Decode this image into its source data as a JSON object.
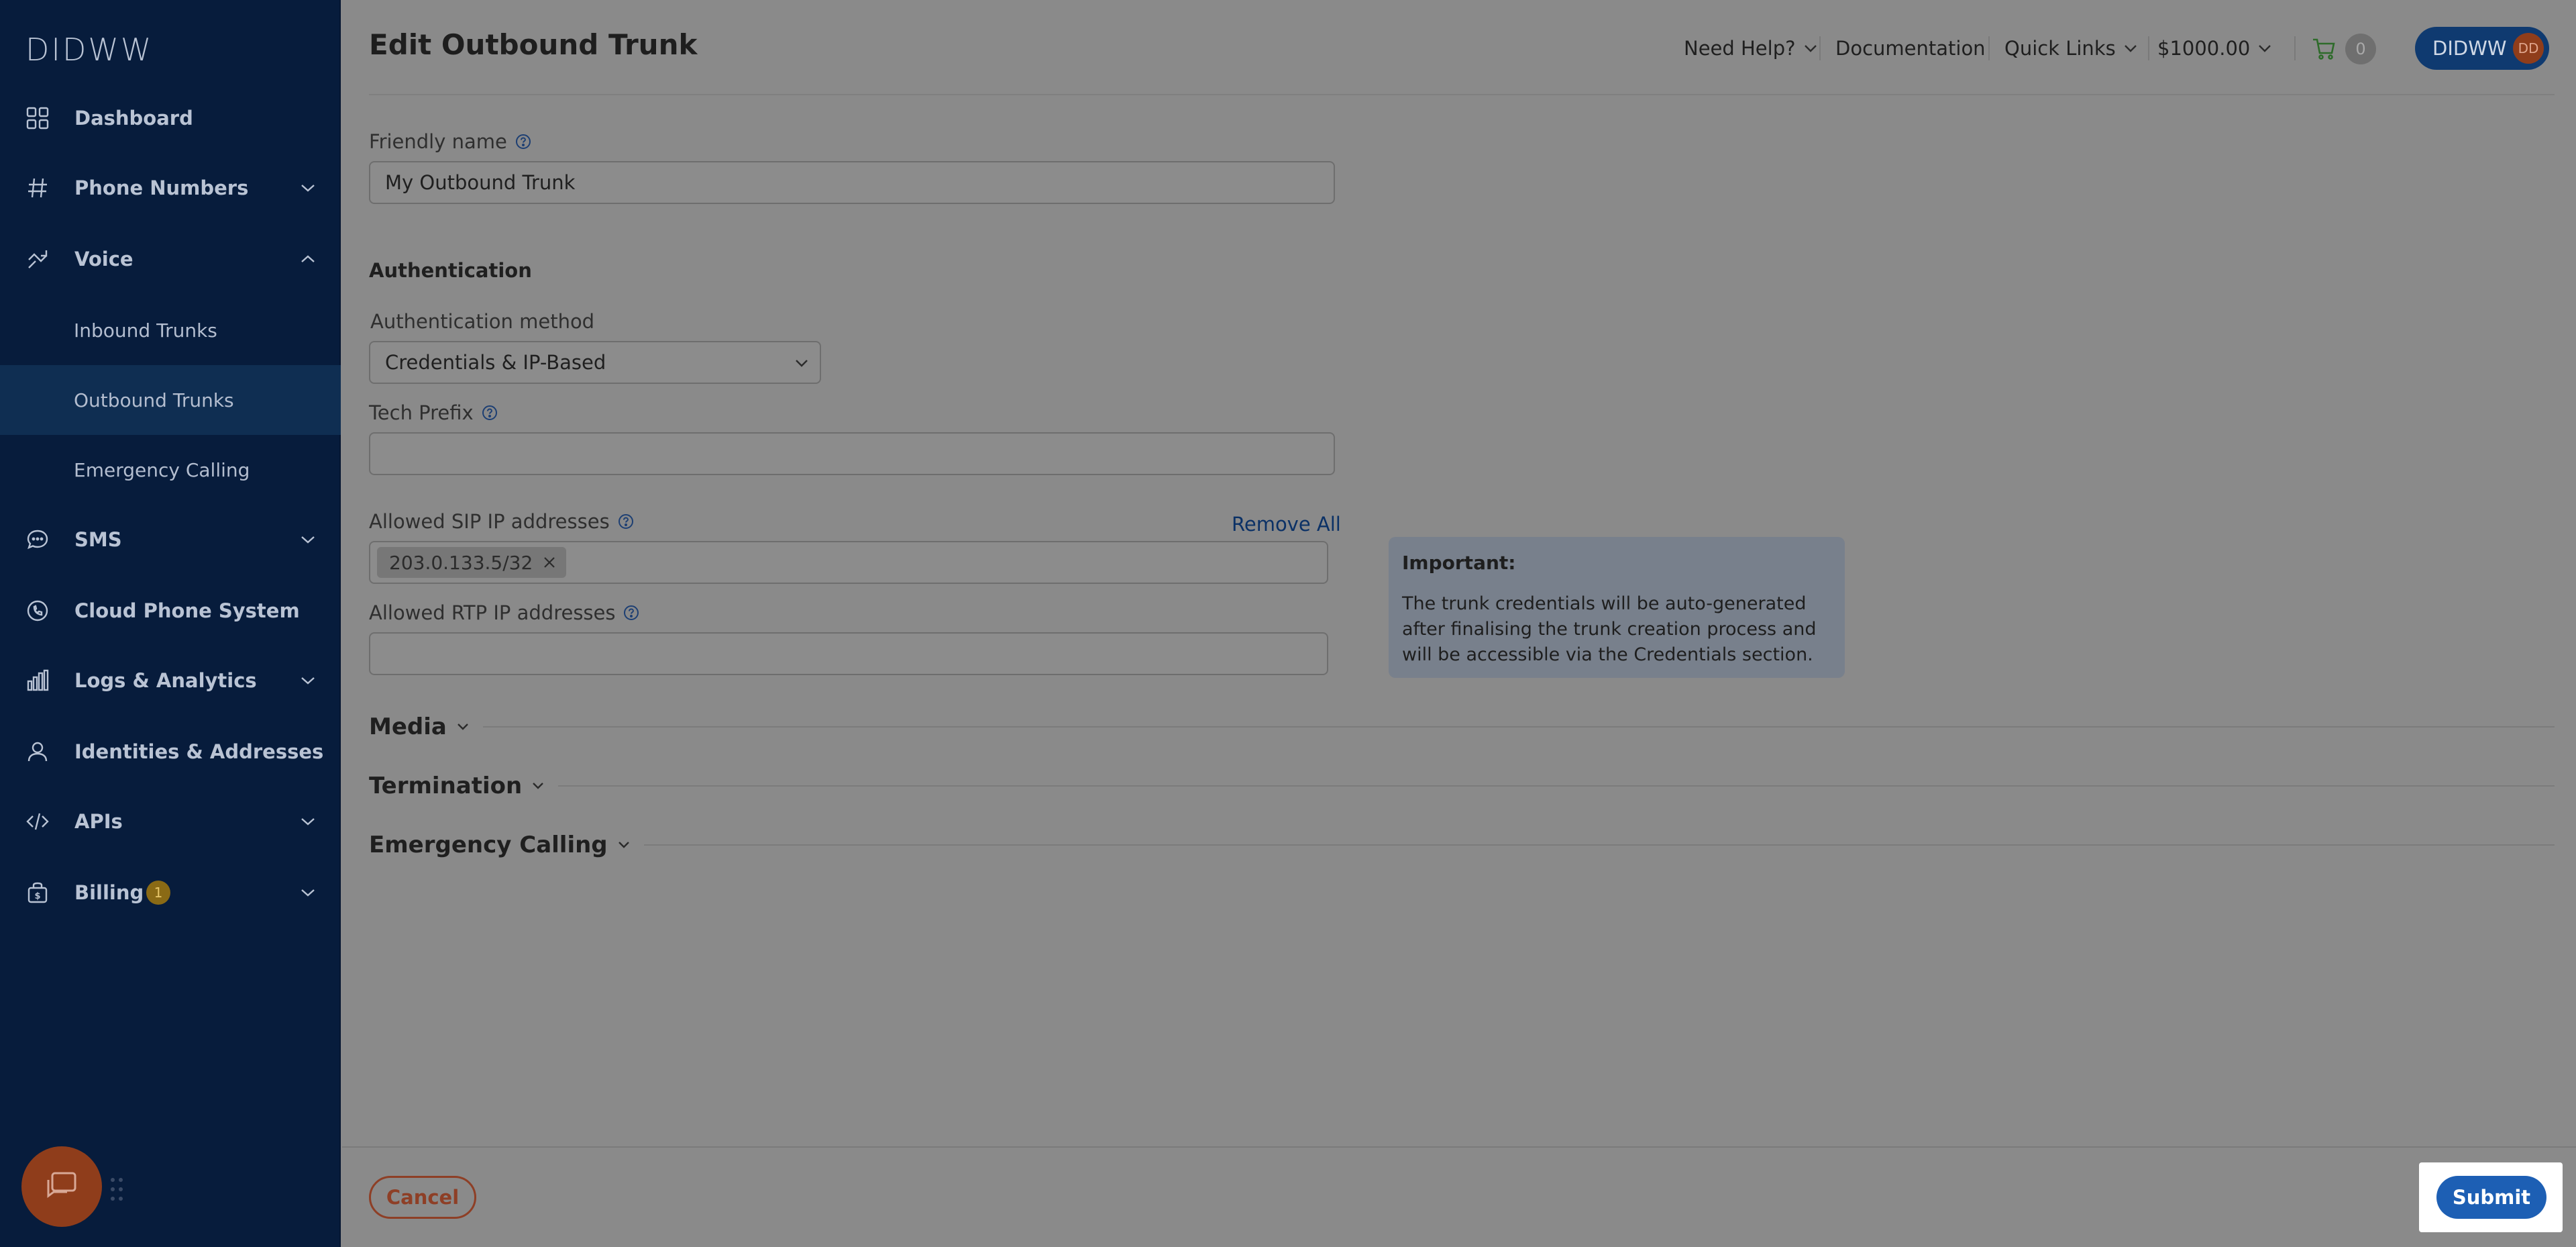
{
  "brand": {
    "logo_text": "DIDWW"
  },
  "sidebar": {
    "items": [
      {
        "label": "Dashboard",
        "icon": "grid-icon"
      },
      {
        "label": "Phone Numbers",
        "icon": "hash-icon"
      },
      {
        "label": "Voice",
        "icon": "voice-icon"
      },
      {
        "label": "SMS",
        "icon": "chat-bubble-icon"
      },
      {
        "label": "Cloud Phone System",
        "icon": "phone-circle-icon"
      },
      {
        "label": "Logs & Analytics",
        "icon": "bar-chart-icon"
      },
      {
        "label": "Identities & Addresses",
        "icon": "user-icon"
      },
      {
        "label": "APIs",
        "icon": "code-icon"
      },
      {
        "label": "Billing",
        "icon": "bag-icon",
        "badge": "1"
      }
    ],
    "voice_sub": [
      {
        "label": "Inbound Trunks"
      },
      {
        "label": "Outbound Trunks",
        "active": true
      },
      {
        "label": "Emergency Calling"
      }
    ]
  },
  "header": {
    "title": "Edit Outbound Trunk",
    "need_help": "Need Help?",
    "documentation": "Documentation",
    "quick_links": "Quick Links",
    "balance": "$1000.00",
    "cart_count": "0",
    "user_name": "DIDWW",
    "user_initials": "DD"
  },
  "form": {
    "friendly_name_label": "Friendly name",
    "friendly_name_value": "My Outbound Trunk",
    "auth_section": "Authentication",
    "auth_method_label": "Authentication method",
    "auth_method_value": "Credentials & IP-Based",
    "tech_prefix_label": "Tech Prefix",
    "tech_prefix_value": "",
    "sip_label": "Allowed SIP IP addresses",
    "remove_all": "Remove All",
    "sip_tags": [
      "203.0.133.5/32"
    ],
    "rtp_label": "Allowed RTP IP addresses",
    "rtp_value": ""
  },
  "info": {
    "title": "Important:",
    "text": "The trunk credentials will be auto-generated after finalising the trunk creation process and will be accessible via the Credentials section."
  },
  "sections": {
    "media": "Media",
    "termination": "Termination",
    "emergency": "Emergency Calling"
  },
  "footer": {
    "cancel": "Cancel",
    "submit": "Submit"
  }
}
